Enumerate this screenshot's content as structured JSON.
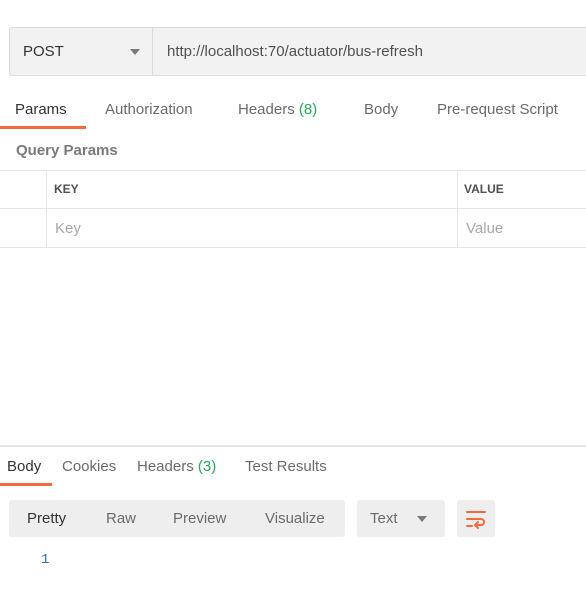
{
  "request": {
    "method": "POST",
    "url": "http://localhost:70/actuator/bus-refresh"
  },
  "request_tabs": {
    "params": "Params",
    "authorization": "Authorization",
    "headers": "Headers",
    "headers_count": "(8)",
    "body": "Body",
    "prerequest": "Pre-request Script"
  },
  "query_params": {
    "title": "Query Params",
    "key_header": "KEY",
    "value_header": "VALUE",
    "key_placeholder": "Key",
    "value_placeholder": "Value"
  },
  "response_tabs": {
    "body": "Body",
    "cookies": "Cookies",
    "headers": "Headers",
    "headers_count": "(3)",
    "test_results": "Test Results"
  },
  "response_toolbar": {
    "pretty": "Pretty",
    "raw": "Raw",
    "preview": "Preview",
    "visualize": "Visualize",
    "language": "Text",
    "wrap_icon": "wrap-lines-icon"
  },
  "response_body": {
    "line_numbers": [
      "1"
    ]
  },
  "colors": {
    "accent": "#f26b3a",
    "count_green": "#26a65b",
    "line_number": "#2d74b8"
  }
}
